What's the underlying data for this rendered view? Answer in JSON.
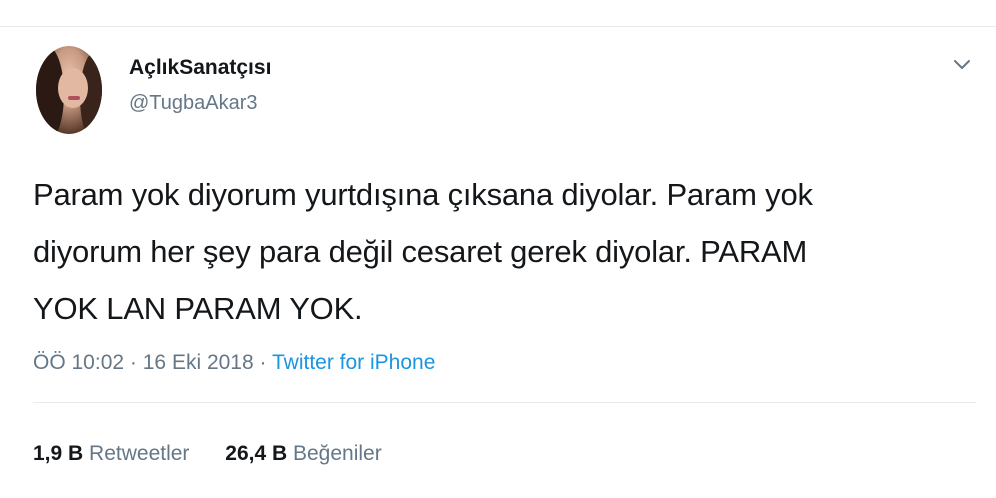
{
  "profile": {
    "display_name": "AçlıkSanatçısı",
    "handle": "@TugbaAkar3"
  },
  "tweet": {
    "lines": [
      "Param yok diyorum yurtdışına çıksana diyolar. Param yok",
      "diyorum her şey para değil cesaret gerek diyolar. PARAM",
      "YOK LAN PARAM YOK."
    ]
  },
  "meta": {
    "time": "ÖÖ 10:02",
    "separator": "·",
    "date": "16 Eki 2018",
    "source": "Twitter for iPhone"
  },
  "stats": {
    "retweets_count": "1,9 B",
    "retweets_label": "Retweetler",
    "likes_count": "26,4 B",
    "likes_label": "Beğeniler"
  },
  "icons": {
    "menu": "chevron-down-icon"
  },
  "colors": {
    "text": "#14171a",
    "secondary": "#657786",
    "link": "#1b95e0",
    "divider": "#e6ecf0"
  }
}
